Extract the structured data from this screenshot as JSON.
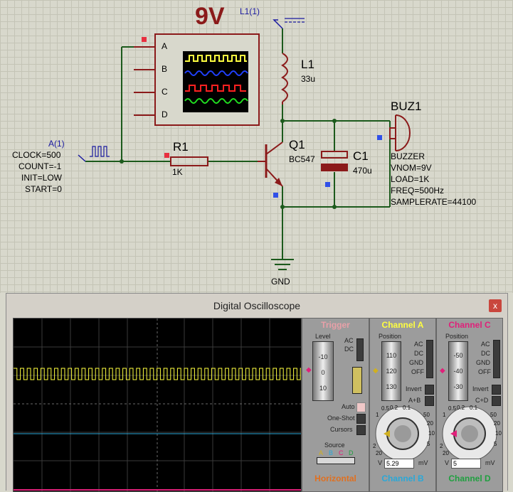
{
  "schematic": {
    "title_voltage": "9V",
    "terminal_l1": "L1(1)",
    "inductor": {
      "ref": "L1",
      "value": "33u"
    },
    "transistor": {
      "ref": "Q1",
      "value": "BC547"
    },
    "capacitor": {
      "ref": "C1",
      "value": "470u"
    },
    "resistor": {
      "ref": "R1",
      "value": "1K"
    },
    "buzzer": {
      "ref": "BUZ1",
      "props": [
        "BUZZER",
        "VNOM=9V",
        "LOAD=1K",
        "FREQ=500Hz",
        "SAMPLERATE=44100"
      ]
    },
    "generator": {
      "ref": "A(1)",
      "props": [
        "CLOCK=500",
        "COUNT=-1",
        "INIT=LOW",
        "START=0"
      ]
    },
    "ground": "GND",
    "scope_inputs": [
      "A",
      "B",
      "C",
      "D"
    ]
  },
  "oscilloscope": {
    "title": "Digital Oscilloscope",
    "close_label": "x",
    "trigger": {
      "header": "Trigger",
      "level_label": "Level",
      "level_ticks": [
        "-10",
        "0",
        "10"
      ],
      "ac": "AC",
      "dc": "DC",
      "auto": "Auto",
      "one_shot": "One-Shot",
      "cursors": "Cursors",
      "source_label": "Source",
      "source_channels": [
        "A",
        "B",
        "C",
        "D"
      ]
    },
    "channel_a": {
      "header": "Channel A",
      "position_label": "Position",
      "ticks": [
        "110",
        "120",
        "130"
      ],
      "ac": "AC",
      "dc": "DC",
      "gnd": "GND",
      "off": "OFF",
      "invert": "Invert",
      "combine": "A+B",
      "dial_ticks": [
        "0.2",
        "0.1",
        "50",
        "20",
        "10",
        "5",
        "2",
        "1",
        "0.5",
        "20"
      ],
      "unit_left": "V",
      "unit_right": "mV",
      "value": "5.29"
    },
    "channel_c": {
      "header": "Channel C",
      "position_label": "Position",
      "ticks": [
        "-50",
        "-40",
        "-30"
      ],
      "ac": "AC",
      "dc": "DC",
      "gnd": "GND",
      "off": "OFF",
      "invert": "Invert",
      "combine": "C+D",
      "dial_ticks": [
        "0.2",
        "0.1",
        "50",
        "20",
        "10",
        "5",
        "2",
        "1",
        "0.5",
        "20"
      ],
      "unit_left": "V",
      "unit_right": "mV",
      "value": "5"
    },
    "bottom_headers": {
      "horizontal": "Horizontal",
      "channel_b": "Channel B",
      "channel_d": "Channel D"
    },
    "colors": {
      "channel_a": "#ffff40",
      "channel_b": "#2aa8d8",
      "channel_c": "#e0207a",
      "channel_d": "#20a040",
      "trigger": "#e8a0a8",
      "horizontal": "#e07020"
    }
  }
}
